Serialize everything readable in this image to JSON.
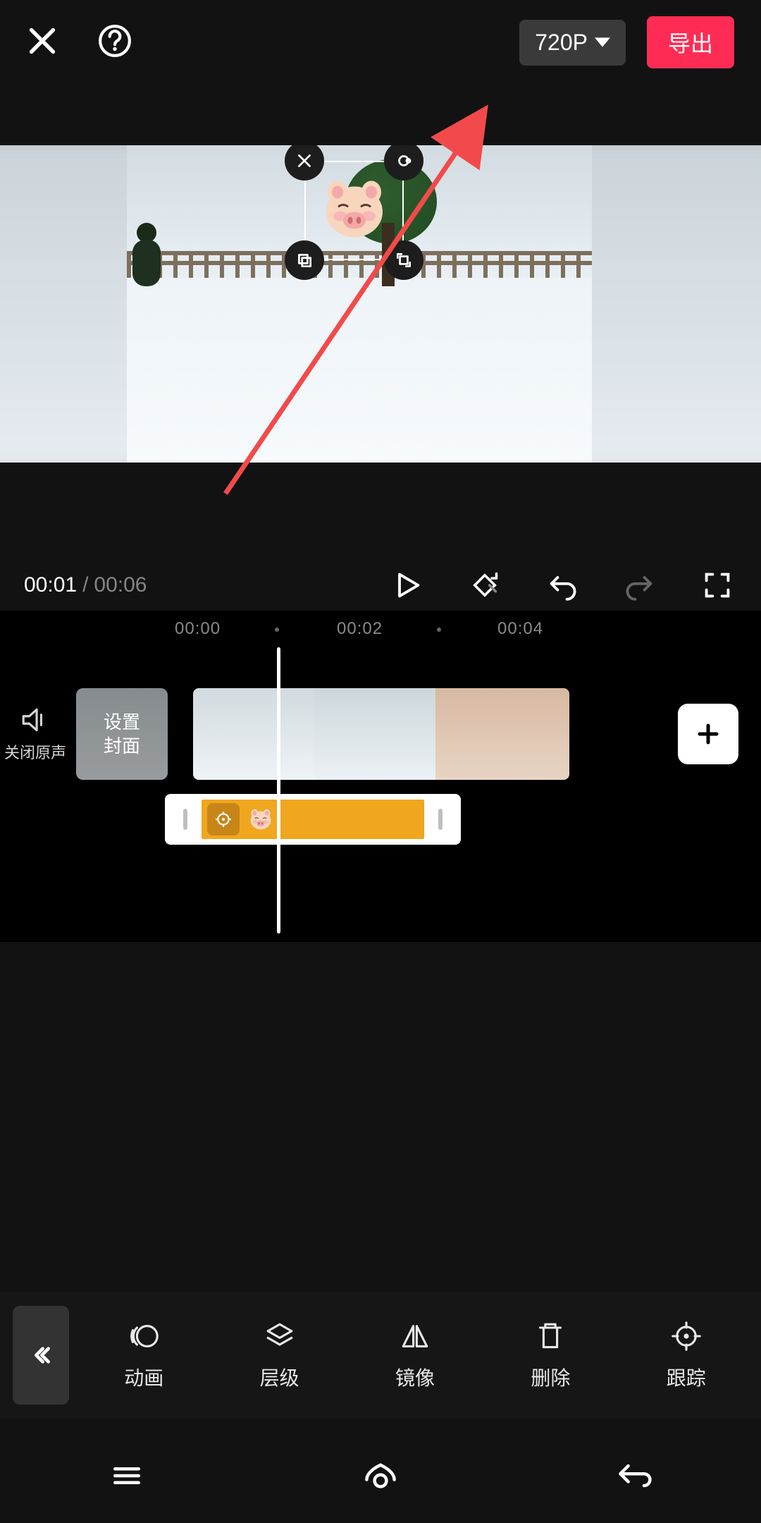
{
  "header": {
    "resolution_label": "720P",
    "export_label": "导出"
  },
  "playback": {
    "current_time": "00:01",
    "separator": "/",
    "total_time": "00:06"
  },
  "timeline": {
    "ruler": {
      "t0": "00:00",
      "t1": "00:02",
      "t2": "00:04"
    },
    "mute_label": "关闭原声",
    "cover": {
      "line1": "设置",
      "line2": "封面"
    }
  },
  "toolbar": {
    "animation": "动画",
    "layer": "层级",
    "mirror": "镜像",
    "delete": "删除",
    "track": "跟踪"
  },
  "icons": {
    "close": "close-icon",
    "help": "help-icon",
    "play": "play-icon",
    "keyframe": "keyframe-icon",
    "undo": "undo-icon",
    "redo": "redo-icon",
    "fullscreen": "fullscreen-icon",
    "mute": "speaker-mute-icon",
    "add": "plus-icon",
    "back": "chevron-left-double-icon",
    "pig": "pig-sticker"
  },
  "colors": {
    "accent": "#fe2c55",
    "sticker_track": "#f0a61e",
    "annotation_arrow": "#f24a4a"
  }
}
